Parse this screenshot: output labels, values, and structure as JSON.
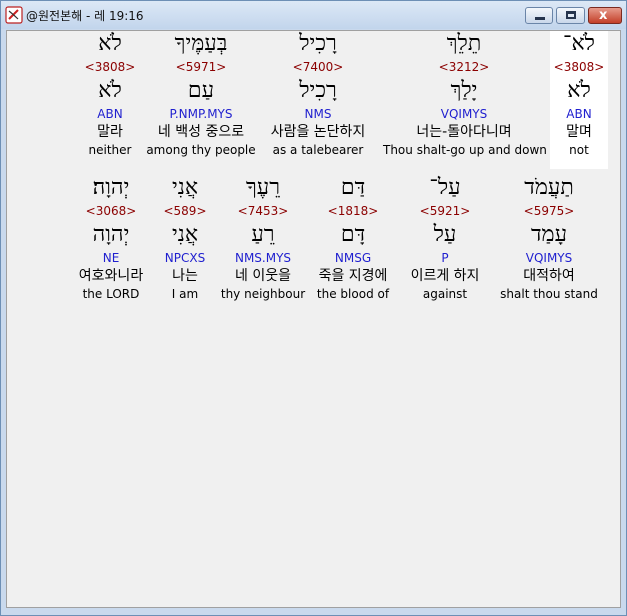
{
  "window": {
    "title": "@원전본해 - 레 19:16",
    "close_glyph": "x"
  },
  "verse_words": [
    [
      {
        "hebrew": "לֹא",
        "strong": "<3808>",
        "lemma": "לֹא",
        "parse": "ABN",
        "korean": "말라",
        "english": "neither"
      },
      {
        "hebrew": "בְּעַמֶּיךָ",
        "strong": "<5971>",
        "lemma": "עַם",
        "parse": "P.NMP.MYS",
        "korean": "네 백성 중으로",
        "english": "among thy people"
      },
      {
        "hebrew": "רָכִיל",
        "strong": "<7400>",
        "lemma": "רָכִיל",
        "parse": "NMS",
        "korean": "사람을 논단하지",
        "english": "as a talebearer"
      },
      {
        "hebrew": "תֵלֵךְ",
        "strong": "<3212>",
        "lemma": "יָלַךְ",
        "parse": "VQIMYS",
        "korean": "너는-돌아다니며",
        "english": "Thou shalt-go up and down"
      },
      {
        "hebrew": "לֹא־",
        "strong": "<3808>",
        "lemma": "לֹא",
        "parse": "ABN",
        "korean": "말며",
        "english": "not"
      }
    ],
    [
      {
        "hebrew": "יְהוָה׃",
        "strong": "<3068>",
        "lemma": "יְהוָה",
        "parse": "NE",
        "korean": "여호와니라",
        "english": "the LORD"
      },
      {
        "hebrew": "אֲנִי",
        "strong": "<589>",
        "lemma": "אֲנִי",
        "parse": "NPCXS",
        "korean": "나는",
        "english": "I am"
      },
      {
        "hebrew": "רֵעֶךָ",
        "strong": "<7453>",
        "lemma": "רֵעַ",
        "parse": "NMS.MYS",
        "korean": "네 이웃을",
        "english": "thy neighbour"
      },
      {
        "hebrew": "דַּם",
        "strong": "<1818>",
        "lemma": "דָּם",
        "parse": "NMSG",
        "korean": "죽을 지경에",
        "english": "the blood of"
      },
      {
        "hebrew": "עַל־",
        "strong": "<5921>",
        "lemma": "עַל",
        "parse": "P",
        "korean": "이르게 하지",
        "english": "against"
      },
      {
        "hebrew": "תַעֲמֹד",
        "strong": "<5975>",
        "lemma": "עָמַד",
        "parse": "VQIMYS",
        "korean": "대적하여",
        "english": "shalt thou stand"
      }
    ]
  ],
  "colors": {
    "strong_number": "#8b0000",
    "parsing": "#1f1fcf",
    "text": "#000000",
    "highlight_bg": "#ffffff",
    "window_frame": "#c9d9ed",
    "close_button": "#c33f28"
  }
}
